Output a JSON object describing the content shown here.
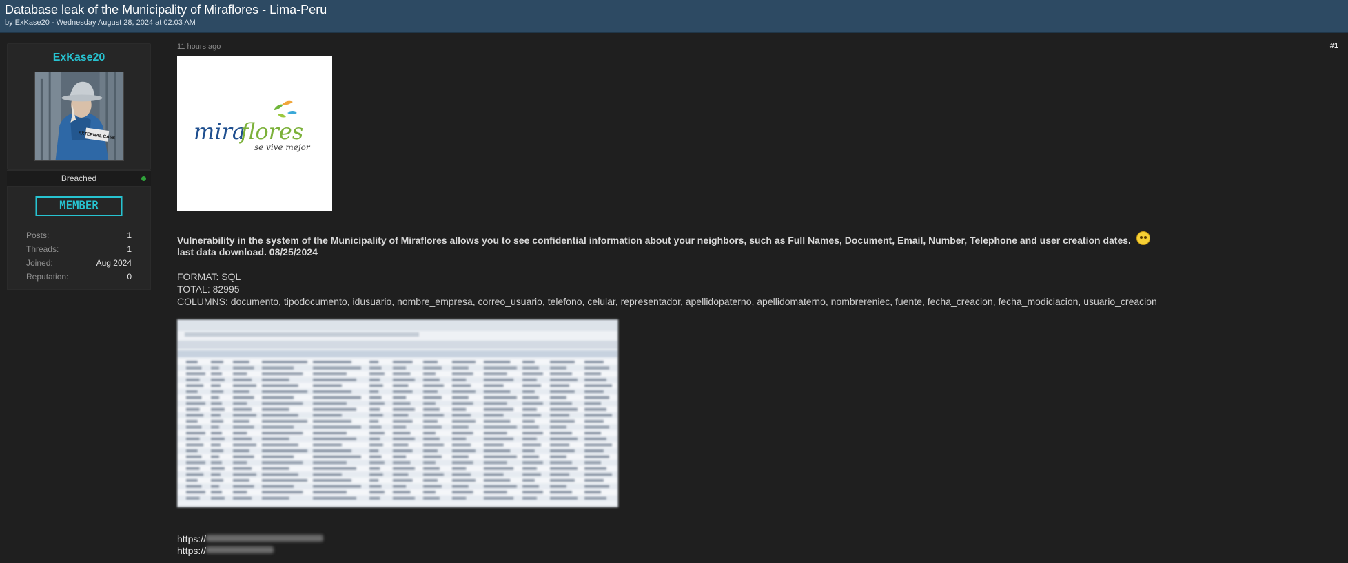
{
  "thread": {
    "title": "Database leak of the Municipality of Miraflores - Lima-Peru",
    "meta": "by ExKase20 - Wednesday August 28, 2024 at 02:03 AM"
  },
  "author": {
    "name": "ExKase20",
    "status": "Breached",
    "role": "MEMBER",
    "stats": [
      {
        "label": "Posts:",
        "value": "1"
      },
      {
        "label": "Threads:",
        "value": "1"
      },
      {
        "label": "Joined:",
        "value": "Aug 2024"
      },
      {
        "label": "Reputation:",
        "value": "0"
      }
    ],
    "avatar_text": "EXTERNAL CASE"
  },
  "post": {
    "time": "11 hours ago",
    "number": "#1",
    "logo": {
      "brand": "miraflores",
      "slogan": "se vive mejor"
    },
    "description": "Vulnerability in the system of the Municipality of Miraflores allows you to see confidential information about your neighbors, such as Full Names, Document, Email, Number, Telephone and user creation dates.",
    "last_download": "last data download. 08/25/2024",
    "format": "FORMAT: SQL",
    "total": "TOTAL: 82995",
    "columns": "COLUMNS: documento, tipodocumento, idusuario, nombre_empresa, correo_usuario, telefono, celular, representador, apellidopaterno, apellidomaterno, nombrereniec, fuente, fecha_creacion, fecha_modiciacion, usuario_creacion",
    "links": [
      "https://",
      "https://"
    ]
  }
}
